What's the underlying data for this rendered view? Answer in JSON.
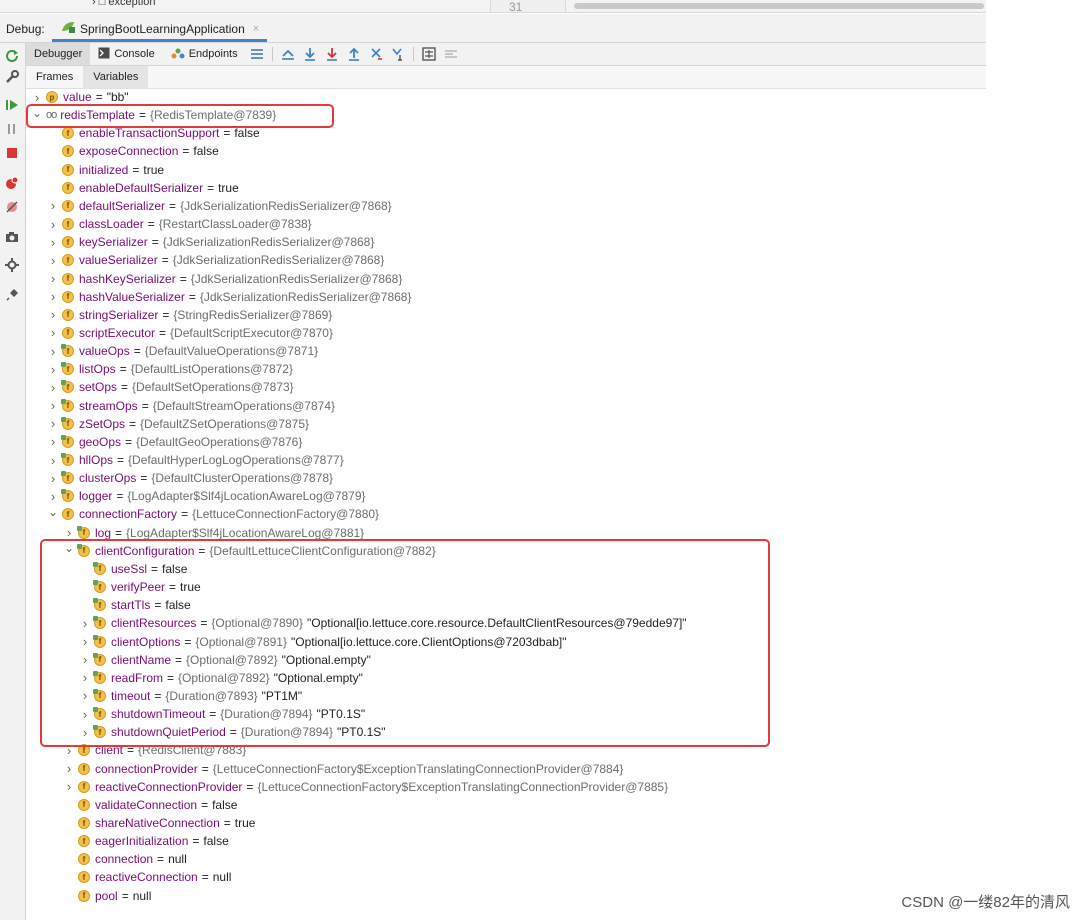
{
  "top": {
    "tree_item": "exception",
    "line_number": "31"
  },
  "debugbar": {
    "label": "Debug:",
    "tab_title": "SpringBootLearningApplication"
  },
  "toolbar": {
    "debugger": "Debugger",
    "console": "Console",
    "endpoints": "Endpoints"
  },
  "subtabs": {
    "frames": "Frames",
    "variables": "Variables"
  },
  "colors": {
    "highlight": "#e23a3a",
    "accent": "#4083c9",
    "field_icon": "#f3c04a"
  },
  "vars": [
    {
      "indent": 0,
      "expand": "closed",
      "icon": "p",
      "name": "value",
      "eq": "=",
      "ref": "",
      "val": "\"bb\"",
      "str": ""
    },
    {
      "indent": 0,
      "expand": "open",
      "icon": "oo",
      "name": "redisTemplate",
      "eq": "=",
      "ref": "{RedisTemplate@7839}",
      "val": "",
      "str": ""
    },
    {
      "indent": 1,
      "expand": "none",
      "icon": "f",
      "name": "enableTransactionSupport",
      "eq": "=",
      "ref": "",
      "val": "false",
      "str": ""
    },
    {
      "indent": 1,
      "expand": "none",
      "icon": "f",
      "name": "exposeConnection",
      "eq": "=",
      "ref": "",
      "val": "false",
      "str": ""
    },
    {
      "indent": 1,
      "expand": "none",
      "icon": "f",
      "name": "initialized",
      "eq": "=",
      "ref": "",
      "val": "true",
      "str": ""
    },
    {
      "indent": 1,
      "expand": "none",
      "icon": "f",
      "name": "enableDefaultSerializer",
      "eq": "=",
      "ref": "",
      "val": "true",
      "str": ""
    },
    {
      "indent": 1,
      "expand": "closed",
      "icon": "f",
      "name": "defaultSerializer",
      "eq": "=",
      "ref": "{JdkSerializationRedisSerializer@7868}",
      "val": "",
      "str": ""
    },
    {
      "indent": 1,
      "expand": "closed",
      "icon": "f",
      "name": "classLoader",
      "eq": "=",
      "ref": "{RestartClassLoader@7838}",
      "val": "",
      "str": ""
    },
    {
      "indent": 1,
      "expand": "closed",
      "icon": "f",
      "name": "keySerializer",
      "eq": "=",
      "ref": "{JdkSerializationRedisSerializer@7868}",
      "val": "",
      "str": ""
    },
    {
      "indent": 1,
      "expand": "closed",
      "icon": "f",
      "name": "valueSerializer",
      "eq": "=",
      "ref": "{JdkSerializationRedisSerializer@7868}",
      "val": "",
      "str": ""
    },
    {
      "indent": 1,
      "expand": "closed",
      "icon": "f",
      "name": "hashKeySerializer",
      "eq": "=",
      "ref": "{JdkSerializationRedisSerializer@7868}",
      "val": "",
      "str": ""
    },
    {
      "indent": 1,
      "expand": "closed",
      "icon": "f",
      "name": "hashValueSerializer",
      "eq": "=",
      "ref": "{JdkSerializationRedisSerializer@7868}",
      "val": "",
      "str": ""
    },
    {
      "indent": 1,
      "expand": "closed",
      "icon": "f",
      "name": "stringSerializer",
      "eq": "=",
      "ref": "{StringRedisSerializer@7869}",
      "val": "",
      "str": ""
    },
    {
      "indent": 1,
      "expand": "closed",
      "icon": "f",
      "name": "scriptExecutor",
      "eq": "=",
      "ref": "{DefaultScriptExecutor@7870}",
      "val": "",
      "str": ""
    },
    {
      "indent": 1,
      "expand": "closed",
      "icon": "ff",
      "name": "valueOps",
      "eq": "=",
      "ref": "{DefaultValueOperations@7871}",
      "val": "",
      "str": ""
    },
    {
      "indent": 1,
      "expand": "closed",
      "icon": "ff",
      "name": "listOps",
      "eq": "=",
      "ref": "{DefaultListOperations@7872}",
      "val": "",
      "str": ""
    },
    {
      "indent": 1,
      "expand": "closed",
      "icon": "ff",
      "name": "setOps",
      "eq": "=",
      "ref": "{DefaultSetOperations@7873}",
      "val": "",
      "str": ""
    },
    {
      "indent": 1,
      "expand": "closed",
      "icon": "ff",
      "name": "streamOps",
      "eq": "=",
      "ref": "{DefaultStreamOperations@7874}",
      "val": "",
      "str": ""
    },
    {
      "indent": 1,
      "expand": "closed",
      "icon": "ff",
      "name": "zSetOps",
      "eq": "=",
      "ref": "{DefaultZSetOperations@7875}",
      "val": "",
      "str": ""
    },
    {
      "indent": 1,
      "expand": "closed",
      "icon": "ff",
      "name": "geoOps",
      "eq": "=",
      "ref": "{DefaultGeoOperations@7876}",
      "val": "",
      "str": ""
    },
    {
      "indent": 1,
      "expand": "closed",
      "icon": "ff",
      "name": "hllOps",
      "eq": "=",
      "ref": "{DefaultHyperLogLogOperations@7877}",
      "val": "",
      "str": ""
    },
    {
      "indent": 1,
      "expand": "closed",
      "icon": "ff",
      "name": "clusterOps",
      "eq": "=",
      "ref": "{DefaultClusterOperations@7878}",
      "val": "",
      "str": ""
    },
    {
      "indent": 1,
      "expand": "closed",
      "icon": "ff",
      "name": "logger",
      "eq": "=",
      "ref": "{LogAdapter$Slf4jLocationAwareLog@7879}",
      "val": "",
      "str": ""
    },
    {
      "indent": 1,
      "expand": "open",
      "icon": "f",
      "name": "connectionFactory",
      "eq": "=",
      "ref": "{LettuceConnectionFactory@7880}",
      "val": "",
      "str": ""
    },
    {
      "indent": 2,
      "expand": "closed",
      "icon": "ff",
      "name": "log",
      "eq": "=",
      "ref": "{LogAdapter$Slf4jLocationAwareLog@7881}",
      "val": "",
      "str": ""
    },
    {
      "indent": 2,
      "expand": "open",
      "icon": "ff",
      "name": "clientConfiguration",
      "eq": "=",
      "ref": "{DefaultLettuceClientConfiguration@7882}",
      "val": "",
      "str": ""
    },
    {
      "indent": 3,
      "expand": "none",
      "icon": "ff",
      "name": "useSsl",
      "eq": "=",
      "ref": "",
      "val": "false",
      "str": ""
    },
    {
      "indent": 3,
      "expand": "none",
      "icon": "ff",
      "name": "verifyPeer",
      "eq": "=",
      "ref": "",
      "val": "true",
      "str": ""
    },
    {
      "indent": 3,
      "expand": "none",
      "icon": "ff",
      "name": "startTls",
      "eq": "=",
      "ref": "",
      "val": "false",
      "str": ""
    },
    {
      "indent": 3,
      "expand": "closed",
      "icon": "ff",
      "name": "clientResources",
      "eq": "=",
      "ref": "{Optional@7890}",
      "val": "",
      "str": "\"Optional[io.lettuce.core.resource.DefaultClientResources@79edde97]\""
    },
    {
      "indent": 3,
      "expand": "closed",
      "icon": "ff",
      "name": "clientOptions",
      "eq": "=",
      "ref": "{Optional@7891}",
      "val": "",
      "str": "\"Optional[io.lettuce.core.ClientOptions@7203dbab]\""
    },
    {
      "indent": 3,
      "expand": "closed",
      "icon": "ff",
      "name": "clientName",
      "eq": "=",
      "ref": "{Optional@7892}",
      "val": "",
      "str": "\"Optional.empty\""
    },
    {
      "indent": 3,
      "expand": "closed",
      "icon": "ff",
      "name": "readFrom",
      "eq": "=",
      "ref": "{Optional@7892}",
      "val": "",
      "str": "\"Optional.empty\""
    },
    {
      "indent": 3,
      "expand": "closed",
      "icon": "ff",
      "name": "timeout",
      "eq": "=",
      "ref": "{Duration@7893}",
      "val": "",
      "str": "\"PT1M\""
    },
    {
      "indent": 3,
      "expand": "closed",
      "icon": "ff",
      "name": "shutdownTimeout",
      "eq": "=",
      "ref": "{Duration@7894}",
      "val": "",
      "str": "\"PT0.1S\""
    },
    {
      "indent": 3,
      "expand": "closed",
      "icon": "ff",
      "name": "shutdownQuietPeriod",
      "eq": "=",
      "ref": "{Duration@7894}",
      "val": "",
      "str": "\"PT0.1S\""
    },
    {
      "indent": 2,
      "expand": "closed",
      "icon": "f",
      "name": "client",
      "eq": "=",
      "ref": "{RedisClient@7883}",
      "val": "",
      "str": ""
    },
    {
      "indent": 2,
      "expand": "closed",
      "icon": "f",
      "name": "connectionProvider",
      "eq": "=",
      "ref": "{LettuceConnectionFactory$ExceptionTranslatingConnectionProvider@7884}",
      "val": "",
      "str": ""
    },
    {
      "indent": 2,
      "expand": "closed",
      "icon": "f",
      "name": "reactiveConnectionProvider",
      "eq": "=",
      "ref": "{LettuceConnectionFactory$ExceptionTranslatingConnectionProvider@7885}",
      "val": "",
      "str": ""
    },
    {
      "indent": 2,
      "expand": "none",
      "icon": "f",
      "name": "validateConnection",
      "eq": "=",
      "ref": "",
      "val": "false",
      "str": ""
    },
    {
      "indent": 2,
      "expand": "none",
      "icon": "f",
      "name": "shareNativeConnection",
      "eq": "=",
      "ref": "",
      "val": "true",
      "str": ""
    },
    {
      "indent": 2,
      "expand": "none",
      "icon": "f",
      "name": "eagerInitialization",
      "eq": "=",
      "ref": "",
      "val": "false",
      "str": ""
    },
    {
      "indent": 2,
      "expand": "none",
      "icon": "f",
      "name": "connection",
      "eq": "=",
      "ref": "",
      "val": "null",
      "str": ""
    },
    {
      "indent": 2,
      "expand": "none",
      "icon": "f",
      "name": "reactiveConnection",
      "eq": "=",
      "ref": "",
      "val": "null",
      "str": ""
    },
    {
      "indent": 2,
      "expand": "none",
      "icon": "f",
      "name": "pool",
      "eq": "=",
      "ref": "",
      "val": "null",
      "str": ""
    }
  ],
  "watermark": "CSDN @一缕82年的清风"
}
